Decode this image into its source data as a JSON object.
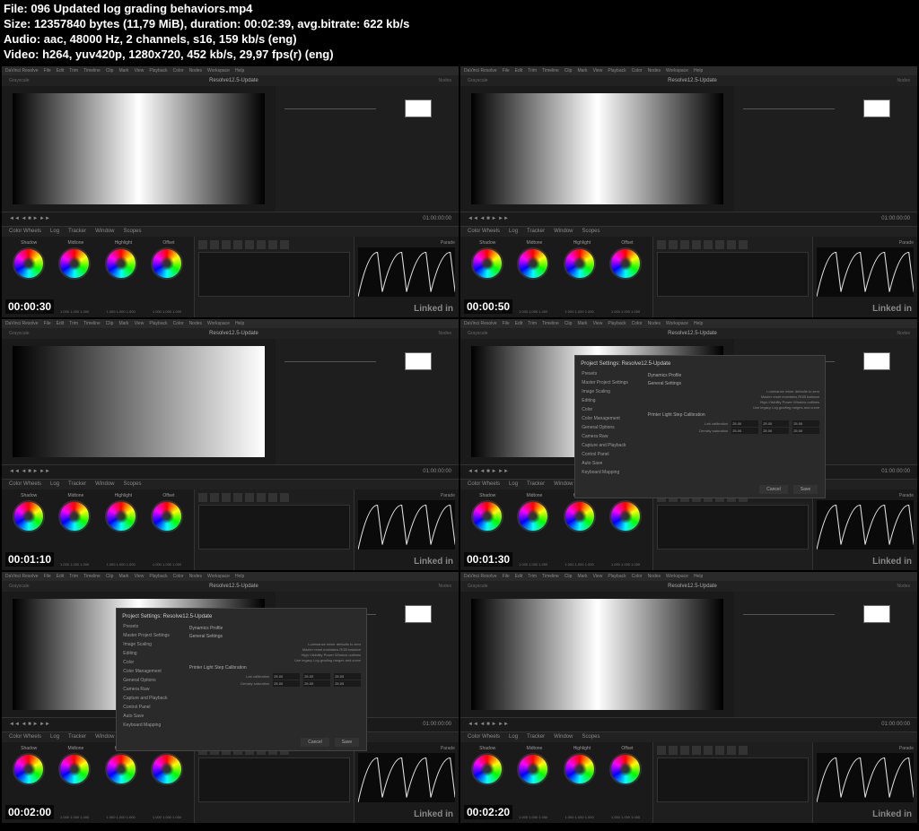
{
  "header": {
    "line1": "File: 096 Updated log grading behaviors.mp4",
    "line2": "Size: 12357840 bytes (11,79 MiB), duration: 00:02:39, avg.bitrate: 622 kb/s",
    "line3": "Audio: aac, 48000 Hz, 2 channels, s16, 159 kb/s (eng)",
    "line4": "Video: h264, yuv420p, 1280x720, 452 kb/s, 29,97 fps(r) (eng)"
  },
  "app": {
    "name": "DaVinci Resolve",
    "menus": [
      "File",
      "Edit",
      "Trim",
      "Timeline",
      "Clip",
      "Mark",
      "View",
      "Playback",
      "Color",
      "Nodes",
      "Workspace",
      "Help"
    ],
    "project": "Resolve12.5-Update",
    "clipName": "Grayscale",
    "timecode": "01:00:00:00",
    "tabs": [
      "Color Wheels",
      "Log",
      "Tracker",
      "Window",
      "Scopes"
    ],
    "wheels": [
      "Shadow",
      "Midtone",
      "Highlight",
      "Offset"
    ],
    "wheelVals": "1.000  1.000  1.000",
    "scopeTitle": "Parade",
    "nodesLabel": "Nodes",
    "clipLabel": "Clip"
  },
  "dialog": {
    "title": "Project Settings: Resolve12.5-Update",
    "sidebar": [
      "Presets",
      "Master Project Settings",
      "Image Scaling",
      "Editing",
      "Color",
      "Color Management",
      "General Options",
      "Camera Raw",
      "Capture and Playback",
      "Control Panel",
      "Auto Save",
      "Keyboard Mapping"
    ],
    "section1": "Dynamics Profile",
    "section2": "General Settings",
    "section3": "Printer Light Step Calibration",
    "opt1": "Luminance mixer defaults to zero",
    "opt2": "Master reset maintains RGB balance",
    "opt3": "High-Visibility Power Window outlines",
    "opt4": "Use legacy Log grading ranges and curve",
    "calib1": "Lab calibration",
    "calib2": "Density saturation",
    "btnCancel": "Cancel",
    "btnSave": "Save"
  },
  "thumbs": [
    {
      "tc": "00:00:30",
      "dialog": false,
      "gradient": "normal"
    },
    {
      "tc": "00:00:50",
      "dialog": false,
      "gradient": "normal"
    },
    {
      "tc": "00:01:10",
      "dialog": false,
      "gradient": "reverse"
    },
    {
      "tc": "00:01:30",
      "dialog": true,
      "gradient": "normal"
    },
    {
      "tc": "00:02:00",
      "dialog": true,
      "gradient": "normal"
    },
    {
      "tc": "00:02:20",
      "dialog": false,
      "gradient": "normal"
    }
  ],
  "watermark": "Linked in"
}
